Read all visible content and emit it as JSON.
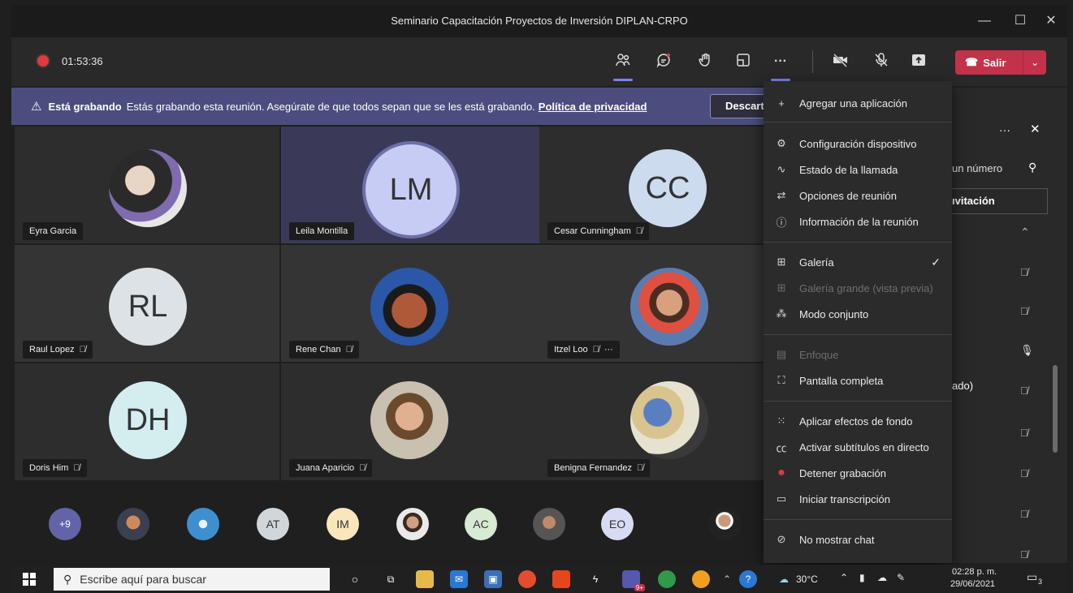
{
  "window": {
    "title": "Seminario Capacitación Proyectos de Inversión DIPLAN-CRPO",
    "minimize": "—",
    "maximize": "☐",
    "close": "✕"
  },
  "toolbar": {
    "recording_time": "01:53:36",
    "leave_label": "Salir",
    "leave_caret": "⌄",
    "more_label": "···"
  },
  "banner": {
    "title": "Está grabando",
    "message": "Estás grabando esta reunión. Asegúrate de que todos sepan que se les está grabando.",
    "link": "Política de privacidad",
    "dismiss": "Descart"
  },
  "participants": [
    {
      "name": "Eyra Garcia",
      "muted": false
    },
    {
      "name": "Leila Montilla",
      "initials": "LM",
      "muted": false
    },
    {
      "name": "Cesar Cunningham",
      "initials": "CC",
      "muted": true
    },
    {
      "name": "Raul Lopez",
      "initials": "RL",
      "muted": true
    },
    {
      "name": "Rene Chan",
      "muted": true
    },
    {
      "name": "Itzel Loo",
      "muted": true,
      "more": "···"
    },
    {
      "name": "Doris Him",
      "initials": "DH",
      "muted": true
    },
    {
      "name": "Juana Aparicio",
      "muted": true
    },
    {
      "name": "Benigna Fernandez",
      "muted": true
    }
  ],
  "strip": {
    "overflow": "+9",
    "initials": [
      "AT",
      "IM",
      "AC",
      "EO"
    ]
  },
  "menu": {
    "items": [
      {
        "label": "Agregar una aplicación",
        "icon": "+"
      },
      {
        "label": "Configuración dispositivo",
        "icon": "⚙"
      },
      {
        "label": "Estado de la llamada",
        "icon": "∿"
      },
      {
        "label": "Opciones de reunión",
        "icon": "⇄"
      },
      {
        "label": "Información de la reunión",
        "icon": "ⓘ"
      },
      {
        "label": "Galería",
        "icon": "⊞",
        "checked": "✓"
      },
      {
        "label": "Galería grande (vista previa)",
        "icon": "⊞"
      },
      {
        "label": "Modo conjunto",
        "icon": "⁂"
      },
      {
        "label": "Enfoque",
        "icon": "▤"
      },
      {
        "label": "Pantalla completa",
        "icon": "⛶"
      },
      {
        "label": "Aplicar efectos de fondo",
        "icon": "⁙"
      },
      {
        "label": "Activar subtítulos en directo",
        "icon": "㏄"
      },
      {
        "label": "Detener grabación",
        "icon": "●"
      },
      {
        "label": "Iniciar transcripción",
        "icon": "▭"
      },
      {
        "label": "No mostrar chat",
        "icon": "⊘"
      }
    ]
  },
  "side_panel": {
    "more": "···",
    "close": "✕",
    "search_fragment": "un número",
    "invite_fragment": "ıvitación",
    "status_fragment": "ado)"
  },
  "taskbar": {
    "search_placeholder": "Escribe aquí para buscar",
    "weather": "30°C",
    "time": "02:28 p. m.",
    "date": "29/06/2021",
    "teams_badge": "9+",
    "notification_count": "3"
  },
  "colors": {
    "accent": "#7b83eb",
    "leave": "#c4314b",
    "banner": "#4b4d7e",
    "record": "#e0393e"
  }
}
